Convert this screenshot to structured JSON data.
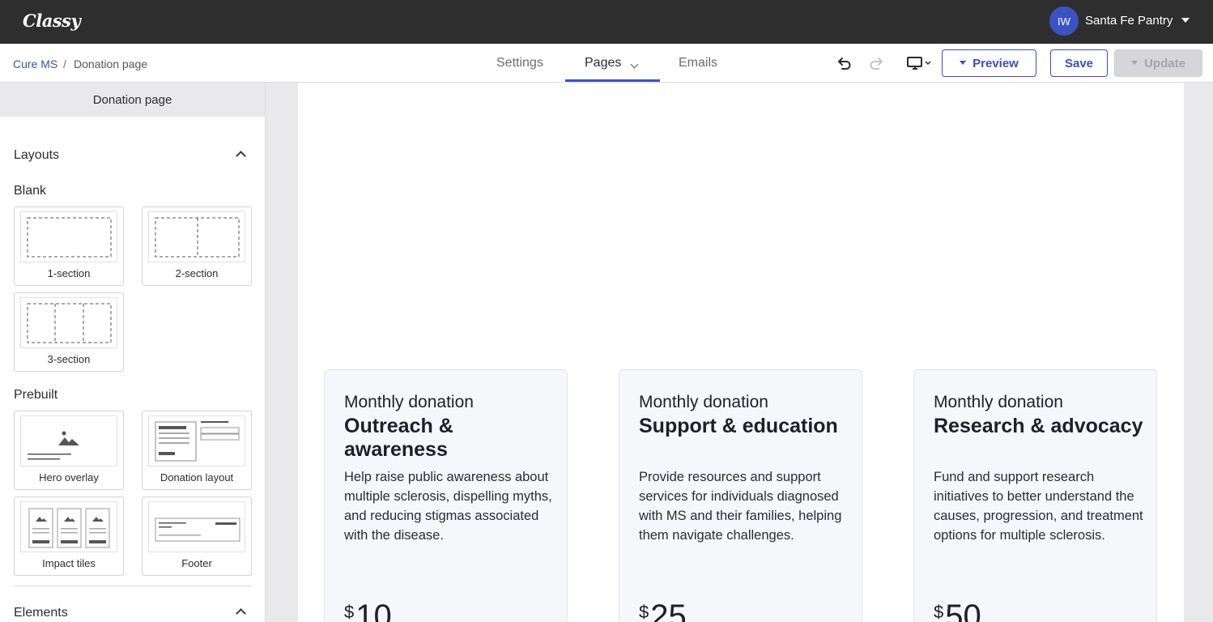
{
  "topbar": {
    "logo": "Classy",
    "avatar_initials": "IW",
    "org_name": "Santa Fe Pantry"
  },
  "breadcrumb": {
    "parent": "Cure MS",
    "separator": "/",
    "current": "Donation page"
  },
  "tabs": [
    {
      "label": "Settings",
      "active": false
    },
    {
      "label": "Pages",
      "active": true
    },
    {
      "label": "Emails",
      "active": false
    }
  ],
  "toolbar": {
    "undo_icon": "undo-icon",
    "redo_icon": "redo-icon",
    "device_icon": "desktop-icon",
    "preview_label": "Preview",
    "save_label": "Save",
    "update_label": "Update"
  },
  "sidebar": {
    "header": "Donation page",
    "layouts_title": "Layouts",
    "blank_label": "Blank",
    "blank_tiles": [
      {
        "label": "1-section"
      },
      {
        "label": "2-section"
      },
      {
        "label": "3-section"
      }
    ],
    "prebuilt_label": "Prebuilt",
    "prebuilt_tiles": [
      {
        "label": "Hero overlay"
      },
      {
        "label": "Donation layout"
      },
      {
        "label": "Impact tiles"
      },
      {
        "label": "Footer"
      }
    ],
    "elements_title": "Elements"
  },
  "cards": [
    {
      "kicker": "Monthly donation",
      "title": "Outreach & awareness",
      "description": "Help raise public awareness about multiple sclerosis, dispelling myths, and reducing stigmas associated with the disease.",
      "currency": "$",
      "amount": "10"
    },
    {
      "kicker": "Monthly donation",
      "title": "Support & education",
      "description": "Provide resources and support services for individuals diagnosed with MS and their families, helping them navigate challenges.",
      "currency": "$",
      "amount": "25"
    },
    {
      "kicker": "Monthly donation",
      "title": "Research & advocacy",
      "description": "Fund and support research initiatives to better understand the causes, progression, and treatment options for multiple sclerosis.",
      "currency": "$",
      "amount": "50"
    }
  ],
  "colors": {
    "topbar": "#2e2e2e",
    "accent": "#3b4fb5",
    "avatar": "#3b53c2"
  }
}
